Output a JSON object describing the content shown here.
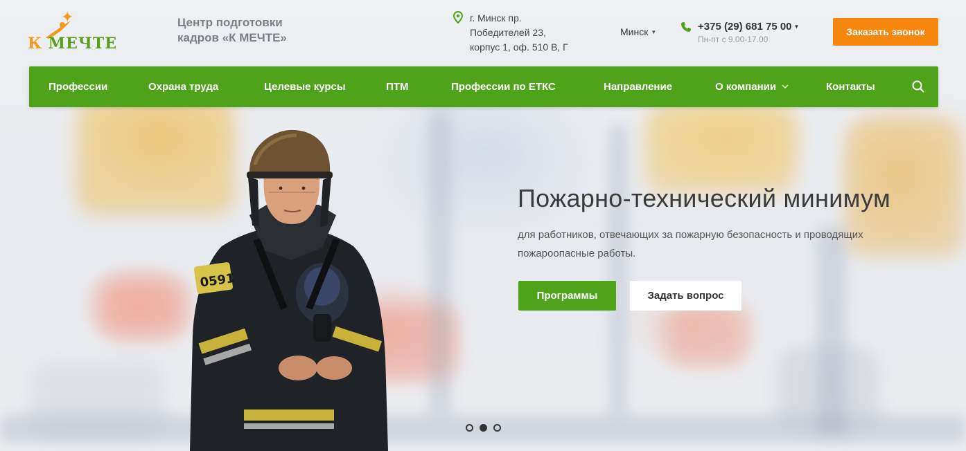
{
  "header": {
    "logo_text_k": "К",
    "logo_text_rest": " МЕЧТЕ",
    "company_name": "Центр подготовки кадров «К МЕЧТЕ»",
    "address_line1": "г. Минск пр.",
    "address_line2": "Победителей 23,",
    "address_line3": "корпус 1, оф. 510 В, Г",
    "city": "Минск",
    "phone": "+375 (29) 681 75 00",
    "hours": "Пн-пт с 9.00-17.00",
    "callback_button": "Заказать звонок"
  },
  "nav": {
    "items": [
      {
        "label": "Профессии"
      },
      {
        "label": "Охрана труда"
      },
      {
        "label": "Целевые курсы"
      },
      {
        "label": "ПТМ"
      },
      {
        "label": "Профессии по ЕТКС"
      },
      {
        "label": "Направление"
      },
      {
        "label": "О компании"
      },
      {
        "label": "Контакты"
      }
    ]
  },
  "hero": {
    "title": "Пожарно-технический минимум",
    "subtitle": "для работников, отвечающих за пожарную безопасность и проводящих пожароопасные работы.",
    "primary_button": "Программы",
    "secondary_button": "Задать вопрос",
    "badge_number": "0591",
    "slides_total": 3,
    "active_slide": 2
  },
  "colors": {
    "brand_green": "#4ea31a",
    "accent_orange": "#f7860f"
  }
}
